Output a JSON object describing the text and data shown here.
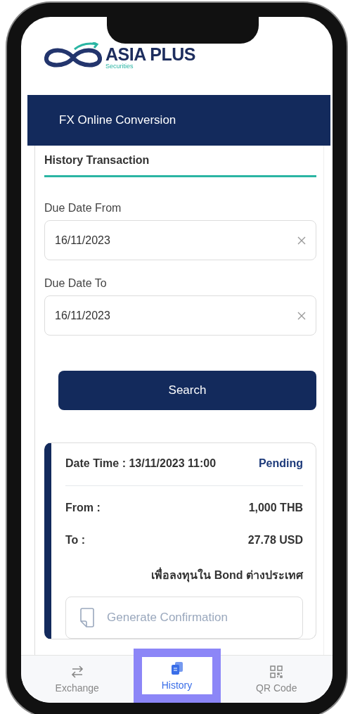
{
  "brand": {
    "name": "ASIA PLUS",
    "tagline": "Securities"
  },
  "header": {
    "title": "FX Online Conversion"
  },
  "section": {
    "title": "History Transaction"
  },
  "fields": [
    {
      "label": "Due Date From",
      "value": "16/11/2023"
    },
    {
      "label": "Due Date To",
      "value": "16/11/2023"
    }
  ],
  "search_button": "Search",
  "transactions": [
    {
      "datetime": "Date Time : 13/11/2023 11:00",
      "status": "Pending",
      "rows": [
        {
          "label": "From :",
          "value": "1,000 THB"
        },
        {
          "label": "To :",
          "value": "27.78 USD"
        }
      ],
      "purpose": "เพื่อลงทุนใน Bond ต่างประเทศ",
      "action": "Generate Confirmation"
    }
  ],
  "bottom_nav": [
    {
      "label": "Exchange",
      "kind": "exchange",
      "selected": false
    },
    {
      "label": "History",
      "kind": "history",
      "selected": true
    },
    {
      "label": "QR Code",
      "kind": "qr",
      "selected": false
    }
  ]
}
